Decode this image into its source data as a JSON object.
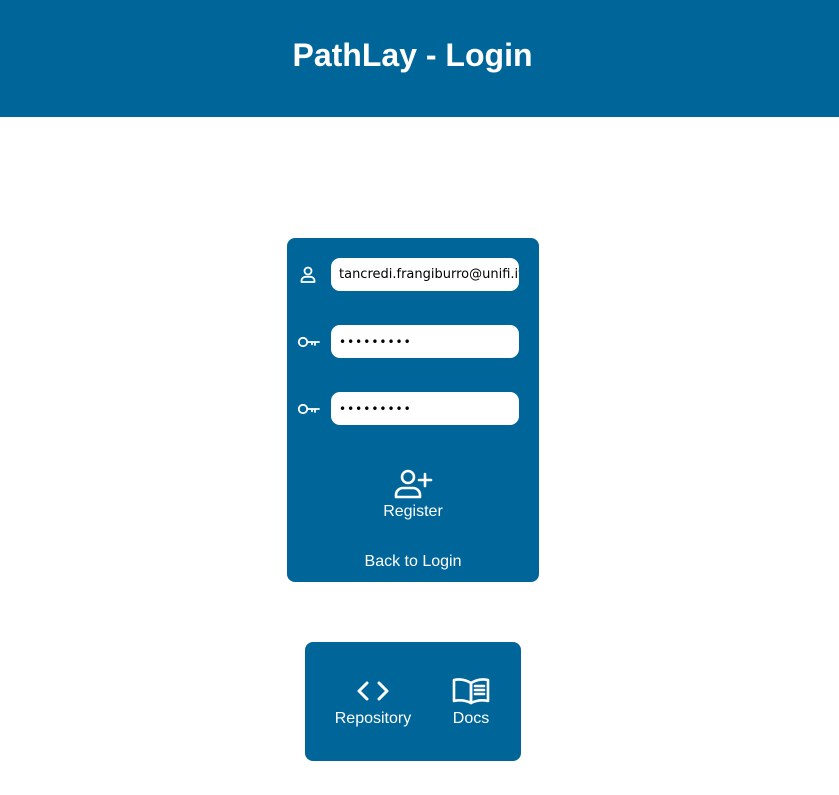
{
  "header": {
    "title": "PathLay - Login"
  },
  "register_form": {
    "username": {
      "value": "tancredi.frangiburro@unifi.it",
      "icon": "user-icon"
    },
    "password": {
      "value": "123456789",
      "icon": "key-icon"
    },
    "confirm_password": {
      "value": "123456789",
      "icon": "key-icon"
    },
    "register_label": "Register",
    "register_icon": "user-plus-icon",
    "back_label": "Back to Login"
  },
  "footer": {
    "repository_label": "Repository",
    "repository_icon": "code-icon",
    "docs_label": "Docs",
    "docs_icon": "book-icon"
  },
  "colors": {
    "primary": "#006699",
    "background": "#ffffff",
    "text_on_primary": "#ffffff"
  }
}
